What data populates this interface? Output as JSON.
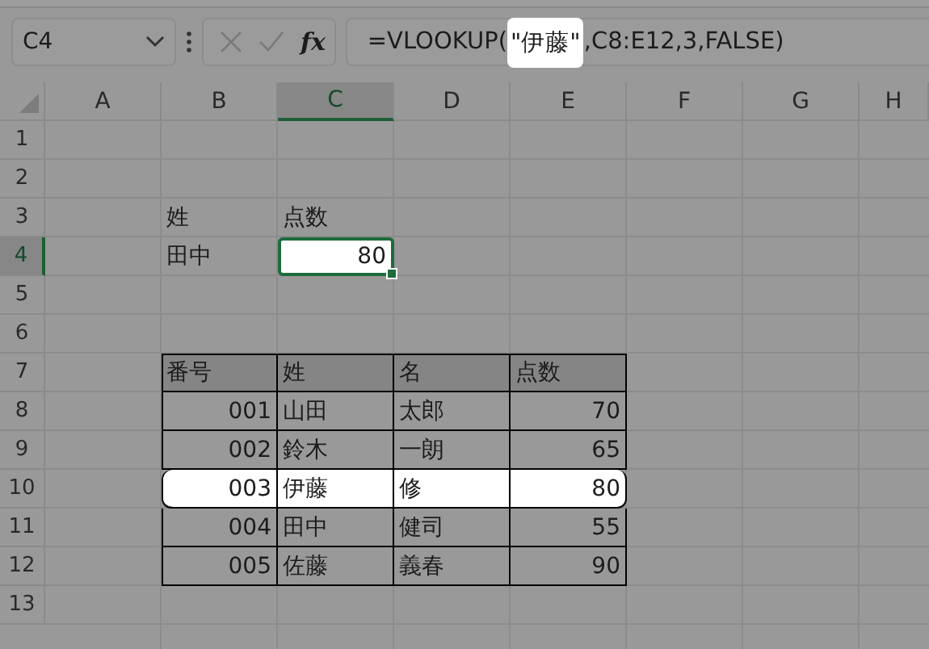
{
  "formula_bar": {
    "name_box": "C4",
    "function_label": "fx",
    "formula": [
      {
        "text": "=VLOOKUP(",
        "highlighted": false
      },
      {
        "text": "\"伊藤\"",
        "highlighted": true
      },
      {
        "text": ",C8:E12,3,FALSE)",
        "highlighted": false
      }
    ]
  },
  "sheet": {
    "columns": [
      {
        "label": "A",
        "selected": false
      },
      {
        "label": "B",
        "selected": false
      },
      {
        "label": "C",
        "selected": true
      },
      {
        "label": "D",
        "selected": false
      },
      {
        "label": "E",
        "selected": false
      },
      {
        "label": "F",
        "selected": false
      },
      {
        "label": "G",
        "selected": false
      },
      {
        "label": "H",
        "selected": false
      }
    ],
    "rows": [
      {
        "label": "1",
        "selected": false
      },
      {
        "label": "2",
        "selected": false
      },
      {
        "label": "3",
        "selected": false
      },
      {
        "label": "4",
        "selected": true
      },
      {
        "label": "5",
        "selected": false
      },
      {
        "label": "6",
        "selected": false
      },
      {
        "label": "7",
        "selected": false
      },
      {
        "label": "8",
        "selected": false
      },
      {
        "label": "9",
        "selected": false
      },
      {
        "label": "10",
        "selected": false
      },
      {
        "label": "11",
        "selected": false
      },
      {
        "label": "12",
        "selected": false
      },
      {
        "label": "13",
        "selected": false
      }
    ]
  },
  "lookup": {
    "key_header": "姓",
    "result_header": "点数",
    "key": "田中",
    "result": "80",
    "result_highlighted": true
  },
  "table": {
    "columns": [
      "番号",
      "姓",
      "名",
      "点数"
    ],
    "rows": [
      {
        "cells": [
          "001",
          "山田",
          "太郎",
          "70"
        ],
        "highlighted": false
      },
      {
        "cells": [
          "002",
          "鈴木",
          "一朗",
          "65"
        ],
        "highlighted": false
      },
      {
        "cells": [
          "003",
          "伊藤",
          "修",
          "80"
        ],
        "highlighted": true
      },
      {
        "cells": [
          "004",
          "田中",
          "健司",
          "55"
        ],
        "highlighted": false
      },
      {
        "cells": [
          "005",
          "佐藤",
          "義春",
          "90"
        ],
        "highlighted": false
      }
    ]
  }
}
